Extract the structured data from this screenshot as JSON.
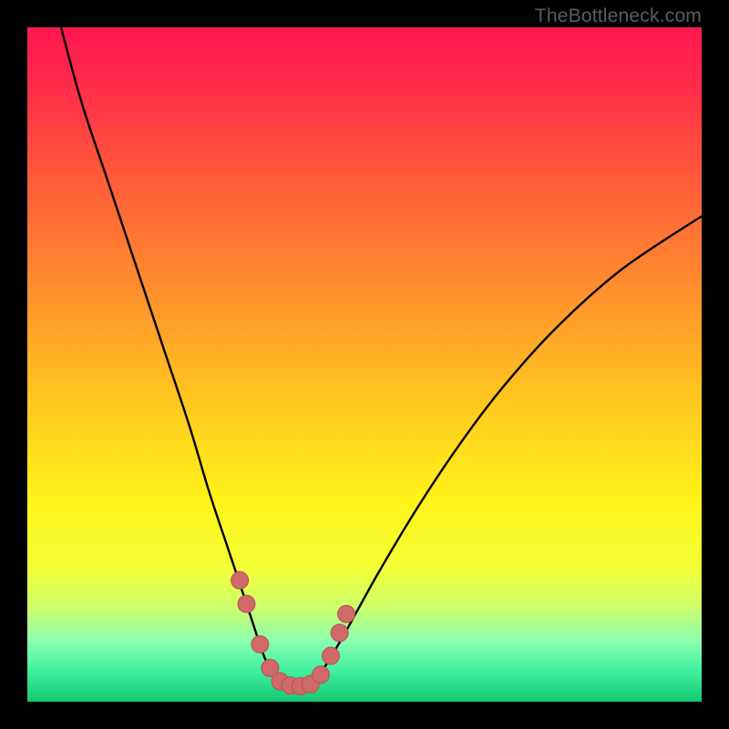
{
  "watermark": "TheBottleneck.com",
  "colors": {
    "frame": "#000000",
    "gradient_stops": [
      {
        "offset": 0.0,
        "color": "#ff1850"
      },
      {
        "offset": 0.08,
        "color": "#ff2a49"
      },
      {
        "offset": 0.22,
        "color": "#ff5a3a"
      },
      {
        "offset": 0.38,
        "color": "#ff8c2e"
      },
      {
        "offset": 0.55,
        "color": "#ffc61f"
      },
      {
        "offset": 0.7,
        "color": "#fff31a"
      },
      {
        "offset": 0.8,
        "color": "#f4ff36"
      },
      {
        "offset": 0.86,
        "color": "#cdff6b"
      },
      {
        "offset": 0.91,
        "color": "#8bffb0"
      },
      {
        "offset": 0.955,
        "color": "#3ef0a0"
      },
      {
        "offset": 1.0,
        "color": "#14c770"
      }
    ],
    "curve": "#000000",
    "markers_fill": "#cf6a69",
    "markers_stroke": "#b6514e"
  },
  "chart_data": {
    "type": "line",
    "title": "",
    "xlabel": "",
    "ylabel": "",
    "xlim": [
      0,
      100
    ],
    "ylim": [
      0,
      100
    ],
    "grid": false,
    "legend": false,
    "series": [
      {
        "name": "bottleneck-curve",
        "x": [
          5,
          8,
          12,
          16,
          20,
          24,
          27,
          30,
          33,
          35,
          36.5,
          38,
          40,
          42,
          44,
          47,
          52,
          58,
          64,
          70,
          78,
          88,
          100
        ],
        "y": [
          100,
          89,
          77,
          65,
          53,
          41,
          31,
          22,
          13,
          7,
          4,
          2.5,
          2.3,
          2.7,
          5,
          10,
          19,
          29,
          38,
          46,
          55,
          64,
          72
        ]
      }
    ],
    "markers": {
      "name": "highlight-points",
      "x": [
        31.5,
        32.5,
        34.5,
        36.0,
        37.5,
        39.0,
        40.5,
        42.0,
        43.5,
        45.0,
        46.3,
        47.3
      ],
      "y": [
        18.0,
        14.5,
        8.5,
        5.0,
        3.0,
        2.4,
        2.3,
        2.6,
        4.0,
        6.8,
        10.2,
        13.0
      ]
    }
  }
}
